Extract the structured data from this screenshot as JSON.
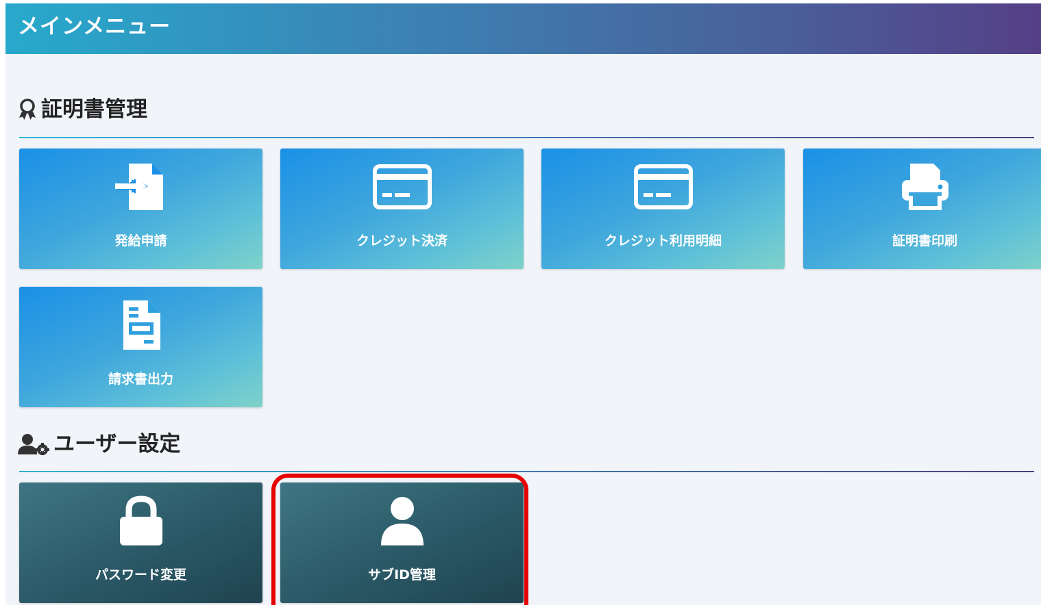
{
  "header": {
    "title": "メインメニュー"
  },
  "sections": [
    {
      "title": "証明書管理",
      "icon": "award-icon",
      "tiles": [
        {
          "label": "発給申請",
          "icon": "file-import-icon"
        },
        {
          "label": "クレジット決済",
          "icon": "credit-card-icon"
        },
        {
          "label": "クレジット利用明細",
          "icon": "credit-card-icon"
        },
        {
          "label": "証明書印刷",
          "icon": "printer-icon"
        },
        {
          "label": "請求書出力",
          "icon": "invoice-icon"
        }
      ]
    },
    {
      "title": "ユーザー設定",
      "icon": "user-gear-icon",
      "tiles": [
        {
          "label": "パスワード変更",
          "icon": "lock-icon"
        },
        {
          "label": "サブID管理",
          "icon": "user-icon"
        }
      ]
    }
  ],
  "colors": {
    "header_start": "#27a9cc",
    "header_end": "#553f87",
    "tile_blue": "#1a90e6",
    "tile_teal": "#7fd2c9",
    "tile_dark": "#2c5b69",
    "highlight": "#e60000"
  }
}
